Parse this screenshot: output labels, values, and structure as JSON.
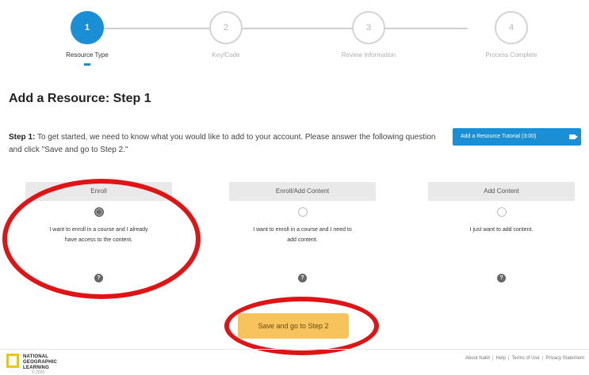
{
  "stepper": {
    "steps": [
      {
        "number": "1",
        "label": "Resource Type"
      },
      {
        "number": "2",
        "label": "Key/Code"
      },
      {
        "number": "3",
        "label": "Review Information"
      },
      {
        "number": "4",
        "label": "Process Complete"
      }
    ],
    "active_step": 1
  },
  "page_title": "Add a Resource: Step 1",
  "intro": {
    "lead": "Step 1:",
    "text": " To get started, we need to know what you would like to add to your account. Please answer the following question and click \"Save and go to Step 2.\""
  },
  "tutorial_button": {
    "label": "Add a Resource Tutorial (3:00)"
  },
  "options": [
    {
      "header": "Enroll",
      "description": "I want to enroll in a course and I already have access to the content.",
      "selected": true
    },
    {
      "header": "Enroll/Add Content",
      "description": "I want to enroll in a course and I need to add content.",
      "selected": false
    },
    {
      "header": "Add Content",
      "description": "I just want to add content.",
      "selected": false
    }
  ],
  "help_glyph": "?",
  "save_button": {
    "label": "Save and go to Step 2"
  },
  "footer": {
    "logo_text": "NATIONAL GEOGRAPHIC LEARNING",
    "copyright": "© 2020",
    "links": [
      "About Nakit",
      "Help",
      "Terms of Use",
      "Privacy Statement"
    ],
    "separator": "|"
  },
  "colors": {
    "accent": "#1a8fd6",
    "save_button": "#f6c35c",
    "annotation": "#e01414"
  }
}
